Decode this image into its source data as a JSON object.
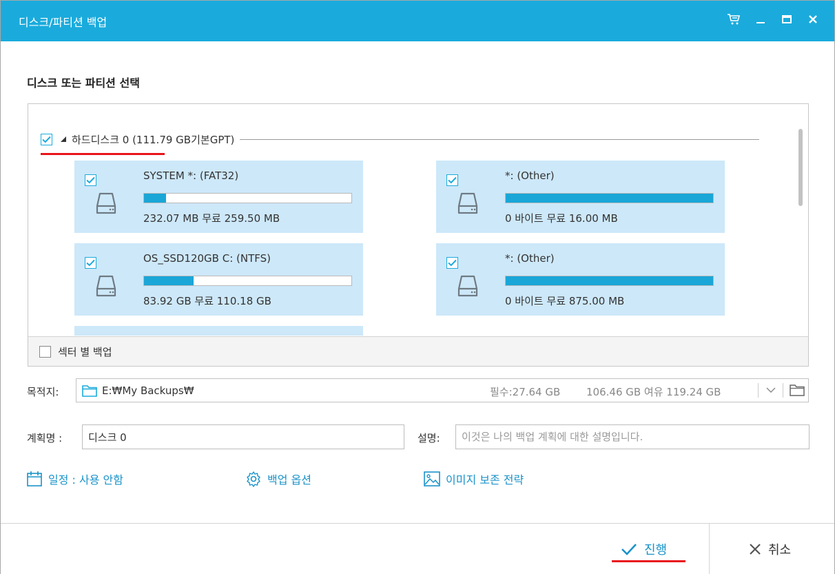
{
  "window": {
    "title": "디스크/파티션 백업"
  },
  "section": {
    "title": "디스크 또는 파티션 선택"
  },
  "disk": {
    "label": "하드디스크 0 (111.79 GB기본GPT)"
  },
  "partitions": [
    {
      "name": "SYSTEM *: (FAT32)",
      "info": "232.07 MB 무료 259.50 MB",
      "used_fraction": 0.106
    },
    {
      "name": "*: (Other)",
      "info": "0 바이트 무료 16.00 MB",
      "used_fraction": 1.0
    },
    {
      "name": "OS_SSD120GB C: (NTFS)",
      "info": "83.92 GB 무료 110.18 GB",
      "used_fraction": 0.238
    },
    {
      "name": "*: (Other)",
      "info": "0 바이트 무료 875.00 MB",
      "used_fraction": 1.0
    }
  ],
  "sector_backup": {
    "label": "섹터 별 백업"
  },
  "destination": {
    "label": "목적지:",
    "path": "E:₩My Backups₩",
    "required": "필수:27.64 GB",
    "free": "106.46 GB 여유 119.24 GB"
  },
  "plan": {
    "label": "계획명 :",
    "value": "디스크 0"
  },
  "description": {
    "label": "설명:",
    "placeholder": "이것은 나의 백업 계획에 대한 설명입니다."
  },
  "options": {
    "schedule": "일정 : 사용 안함",
    "backup_options": "백업 옵션",
    "image_strategy": "이미지 보존 전략"
  },
  "footer": {
    "proceed": "진행",
    "cancel": "취소"
  },
  "colors": {
    "accent": "#1aabdc",
    "card": "#cde8f9",
    "highlight": "#e8141a",
    "link": "#1a93c9"
  }
}
